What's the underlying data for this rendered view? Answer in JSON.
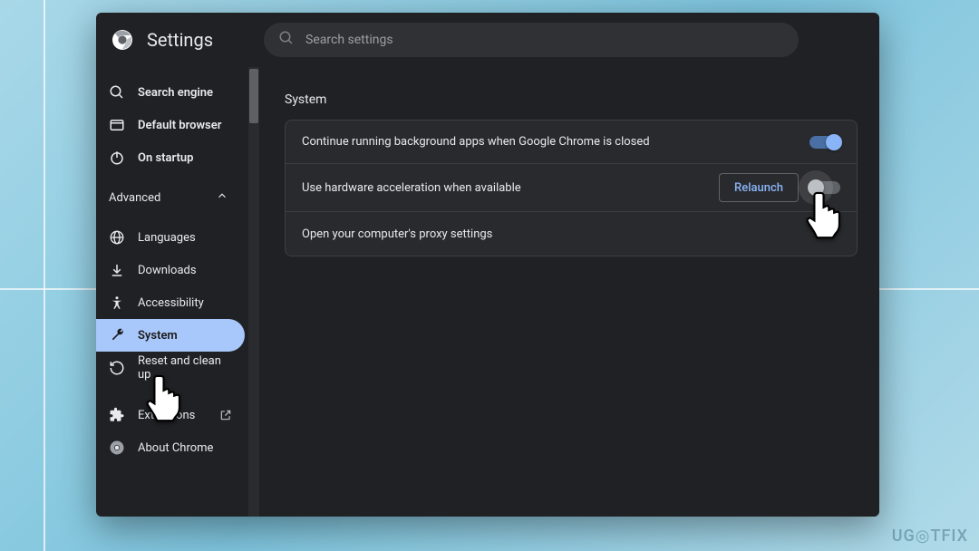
{
  "header": {
    "title": "Settings",
    "search_placeholder": "Search settings"
  },
  "sidebar": {
    "items": [
      {
        "icon": "search-icon",
        "label": "Search engine"
      },
      {
        "icon": "browser-icon",
        "label": "Default browser"
      },
      {
        "icon": "power-icon",
        "label": "On startup"
      }
    ],
    "advanced_label": "Advanced",
    "advanced_items": [
      {
        "icon": "globe-icon",
        "label": "Languages"
      },
      {
        "icon": "download-icon",
        "label": "Downloads"
      },
      {
        "icon": "person-icon",
        "label": "Accessibility"
      },
      {
        "icon": "wrench-icon",
        "label": "System",
        "active": true
      },
      {
        "icon": "history-icon",
        "label": "Reset and clean up"
      }
    ],
    "footer_items": [
      {
        "icon": "puzzle-icon",
        "label": "Extensions",
        "external": true
      },
      {
        "icon": "chrome-icon",
        "label": "About Chrome"
      }
    ]
  },
  "main": {
    "section_title": "System",
    "rows": {
      "bg_apps": "Continue running background apps when Google Chrome is closed",
      "hw_accel": "Use hardware acceleration when available",
      "relaunch": "Relaunch",
      "proxy": "Open your computer's proxy settings"
    }
  },
  "watermark": "UG◎TFIX"
}
